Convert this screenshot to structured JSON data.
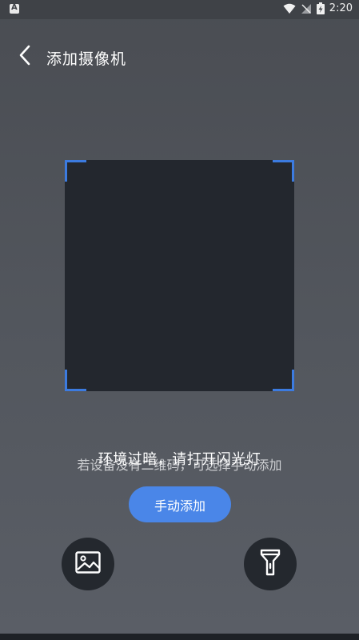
{
  "status_bar": {
    "time": "2:20"
  },
  "header": {
    "title": "添加摄像机"
  },
  "scanner": {
    "corner_color": "#3c7be0"
  },
  "hints": {
    "dark_environment": "环境过暗，请打开闪光灯",
    "no_qr_code": "若设备没有二维码，可选择手动添加"
  },
  "actions": {
    "manual_add_label": "手动添加"
  },
  "icons": {
    "back": "chevron-left-icon",
    "gallery": "image-icon",
    "flash": "flashlight-icon"
  },
  "colors": {
    "accent": "#4a86e8",
    "frame_bg": "#23272e",
    "round_button_bg": "#24282e"
  }
}
